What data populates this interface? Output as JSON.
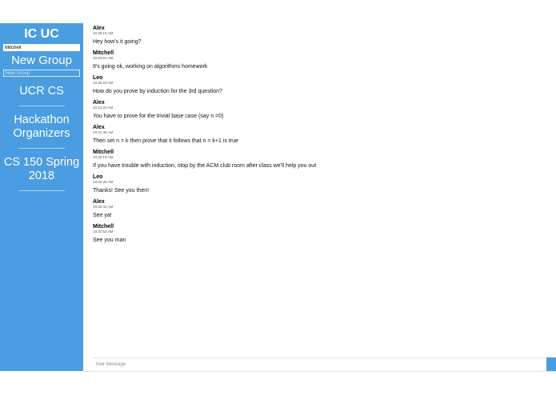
{
  "app": {
    "title": "IC UC"
  },
  "user": {
    "name": "Mitchell"
  },
  "sidebar": {
    "new_group_label": "New Group",
    "new_group_placeholder": "New Group",
    "groups": [
      "UCR CS",
      "Hackathon Organizers",
      "CS 150 Spring 2018"
    ]
  },
  "messages": [
    {
      "sender": "Alex",
      "time": "10:29:15 AM",
      "text": "Hey how's it going?"
    },
    {
      "sender": "Mitchell",
      "time": "10:29:51 AM",
      "text": "It's going ok, working on algorithms homework"
    },
    {
      "sender": "Leo",
      "time": "10:30:24 AM",
      "text": "How do you prove by induction for the 3rd question?"
    },
    {
      "sender": "Alex",
      "time": "10:31:22 AM",
      "text": "You have to prove for the trivial base case (say n =0)"
    },
    {
      "sender": "Alex",
      "time": "10:31:45 AM",
      "text": "Then set n = k then prove that it follows that n = k+1 is true"
    },
    {
      "sender": "Mitchell",
      "time": "10:32:15 AM",
      "text": "If you have trouble with induction, stop by the ACM club room after class we'll help you out"
    },
    {
      "sender": "Leo",
      "time": "10:32:26 AM",
      "text": "Thanks! See you then!"
    },
    {
      "sender": "Alex",
      "time": "10:32:42 AM",
      "text": "See ya!"
    },
    {
      "sender": "Mitchell",
      "time": "10:32:52 AM",
      "text": "See you man"
    }
  ],
  "composer": {
    "placeholder": "Your Message"
  },
  "colors": {
    "sidebar": "#4a9de1",
    "background": "#ffffff"
  }
}
